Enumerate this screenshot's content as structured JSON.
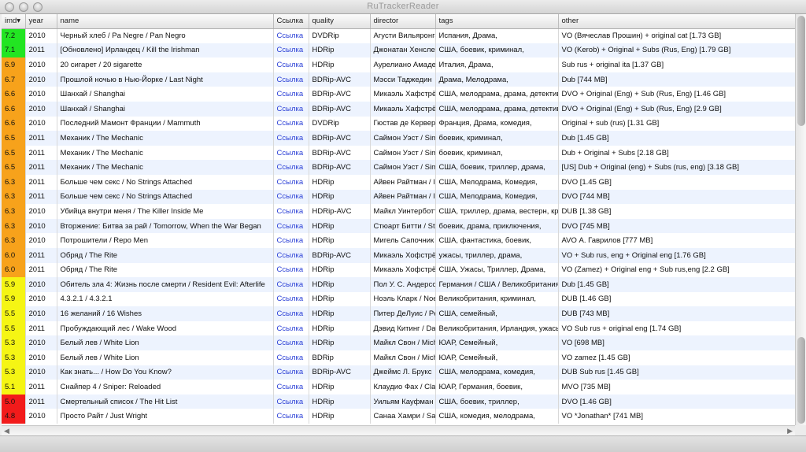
{
  "window": {
    "title": "RuTrackerReader"
  },
  "columns": [
    "imd▾",
    "year",
    "name",
    "Ссылка",
    "quality",
    "director",
    "tags",
    "other"
  ],
  "colors": {
    "green": "#22e522",
    "yellow": "#f5f514",
    "orange": "#f7a21b",
    "red": "#f21b1b",
    "link": "#2a3fd6"
  },
  "rows": [
    {
      "imdb": "7.2",
      "color": "green",
      "year": "2010",
      "name": "Черный хлеб / Pa Negre / Pan Negro",
      "link": "Ссылка",
      "quality": "DVDRip",
      "director": "Агусти Вильяронга",
      "tags": "Испания, Драма,",
      "other": "VO (Вячеслав Прошин) + original cat [1.73 GB]"
    },
    {
      "imdb": "7.1",
      "color": "green",
      "year": "2011",
      "name": "[Обновлено] Ирландец / Kill the Irishman",
      "link": "Ссылка",
      "quality": "HDRip",
      "director": "Джонатан Хенслей",
      "tags": "США, боевик, криминал,",
      "other": "VO (Kerob) + Original + Subs (Rus, Eng) [1.79 GB]"
    },
    {
      "imdb": "6.9",
      "color": "orange",
      "year": "2010",
      "name": "20 сигарет / 20 sigarette",
      "link": "Ссылка",
      "quality": "HDRip",
      "director": "Аурелиано Амадеи",
      "tags": "Италия, Драма,",
      "other": "Sub rus + original ita [1.37 GB]"
    },
    {
      "imdb": "6.7",
      "color": "orange",
      "year": "2010",
      "name": "Прошлой ночью в Нью-Йорке / Last Night",
      "link": "Ссылка",
      "quality": "BDRip-AVC",
      "director": "Мэсси Таджедин",
      "tags": "Драма, Мелодрама,",
      "other": "Dub [744 MB]"
    },
    {
      "imdb": "6.6",
      "color": "orange",
      "year": "2010",
      "name": "Шанхай / Shanghai",
      "link": "Ссылка",
      "quality": "BDRip-AVC",
      "director": "Микаэль Хафстрём",
      "tags": "США, мелодрама, драма, детектив",
      "other": "DVO + Original (Eng) + Sub (Rus, Eng) [1.46 GB]"
    },
    {
      "imdb": "6.6",
      "color": "orange",
      "year": "2010",
      "name": "Шанхай / Shanghai",
      "link": "Ссылка",
      "quality": "BDRip-AVC",
      "director": "Микаэль Хафстрём",
      "tags": "США, мелодрама, драма, детектив",
      "other": "DVO + Original (Eng) + Sub (Rus, Eng) [2.9 GB]"
    },
    {
      "imdb": "6.6",
      "color": "orange",
      "year": "2010",
      "name": "Последний Мамонт Франции / Mammuth",
      "link": "Ссылка",
      "quality": "DVDRip",
      "director": "Гюстав де Керверн",
      "tags": "Франция, Драма, комедия,",
      "other": "Original + sub (rus) [1.31 GB]"
    },
    {
      "imdb": "6.5",
      "color": "orange",
      "year": "2011",
      "name": "Механик / The Mechanic",
      "link": "Ссылка",
      "quality": "BDRip-AVC",
      "director": "Саймон Уэст / Simon",
      "tags": "боевик, криминал,",
      "other": "Dub [1.45 GB]"
    },
    {
      "imdb": "6.5",
      "color": "orange",
      "year": "2011",
      "name": "Механик / The Mechanic",
      "link": "Ссылка",
      "quality": "BDRip-AVC",
      "director": "Саймон Уэст / Simon",
      "tags": "боевик, криминал,",
      "other": "Dub + Original + Subs [2.18 GB]"
    },
    {
      "imdb": "6.5",
      "color": "orange",
      "year": "2011",
      "name": "Механик / The Mechanic",
      "link": "Ссылка",
      "quality": "BDRip-AVC",
      "director": "Саймон Уэст / Simon",
      "tags": "США, боевик, триллер, драма,",
      "other": "[US] Dub + Original (eng) + Subs (rus, eng) [3.18 GB]"
    },
    {
      "imdb": "6.3",
      "color": "orange",
      "year": "2011",
      "name": "Больше чем секс / No Strings Attached",
      "link": "Ссылка",
      "quality": "HDRip",
      "director": "Айвен Райтман / Ivan",
      "tags": "США, Мелодрама, Комедия,",
      "other": "DVO [1.45 GB]"
    },
    {
      "imdb": "6.3",
      "color": "orange",
      "year": "2011",
      "name": "Больше чем секс / No Strings Attached",
      "link": "Ссылка",
      "quality": "HDRip",
      "director": "Айвен Райтман / Ivan",
      "tags": "США, Мелодрама, Комедия,",
      "other": "DVO [744 MB]"
    },
    {
      "imdb": "6.3",
      "color": "orange",
      "year": "2010",
      "name": "Убийца внутри меня / The Killer Inside Me",
      "link": "Ссылка",
      "quality": "HDRip-AVC",
      "director": "Майкл Уинтерботтом",
      "tags": "США, триллер, драма, вестерн, кри",
      "other": "DUB [1.38 GB]"
    },
    {
      "imdb": "6.3",
      "color": "orange",
      "year": "2010",
      "name": "Вторжение: Битва за рай / Tomorrow, When the War Began",
      "link": "Ссылка",
      "quality": "HDRip",
      "director": "Стюарт Битти / Stuart",
      "tags": "боевик, драма, приключения,",
      "other": "DVO [745 MB]"
    },
    {
      "imdb": "6.3",
      "color": "orange",
      "year": "2010",
      "name": "Потрошители / Repo Men",
      "link": "Ссылка",
      "quality": "HDRip",
      "director": "Мигель Сапочник",
      "tags": "США, фантастика, боевик,",
      "other": "AVO А. Гаврилов [777 MB]"
    },
    {
      "imdb": "6.0",
      "color": "orange",
      "year": "2011",
      "name": "Обряд / The Rite",
      "link": "Ссылка",
      "quality": "BDRip-AVC",
      "director": "Микаэль Хофстрём",
      "tags": "ужасы, триллер, драма,",
      "other": "VO + Sub rus, eng + Original eng [1.76 GB]"
    },
    {
      "imdb": "6.0",
      "color": "orange",
      "year": "2011",
      "name": "Обряд / The Rite",
      "link": "Ссылка",
      "quality": "HDRip",
      "director": "Микаэль Хофстрём",
      "tags": "США, Ужасы, Триллер, Драма,",
      "other": "VO (Zamez) + Original eng + Sub rus,eng [2.2 GB]"
    },
    {
      "imdb": "5.9",
      "color": "yellow",
      "year": "2010",
      "name": "Обитель зла 4: Жизнь после смерти / Resident Evil: Afterlife",
      "link": "Ссылка",
      "quality": "HDRip",
      "director": "Пол У. С. Андерсон",
      "tags": "Германия / США / Великобритания",
      "other": "Dub [1.45 GB]"
    },
    {
      "imdb": "5.9",
      "color": "yellow",
      "year": "2010",
      "name": "4.3.2.1 / 4.3.2.1",
      "link": "Ссылка",
      "quality": "HDRip",
      "director": "Ноэль Кларк / Noel",
      "tags": "Великобритания, криминал,",
      "other": "DUB [1.46 GB]"
    },
    {
      "imdb": "5.5",
      "color": "yellow",
      "year": "2010",
      "name": "16 желаний / 16 Wishes",
      "link": "Ссылка",
      "quality": "HDRip",
      "director": "Питер ДеЛуис / Peter",
      "tags": "США, семейный,",
      "other": "DUB [743 MB]"
    },
    {
      "imdb": "5.5",
      "color": "yellow",
      "year": "2011",
      "name": "Пробуждающий лес / Wake Wood",
      "link": "Ссылка",
      "quality": "HDRip",
      "director": "Дэвид Китинг / David",
      "tags": "Великобритания, Ирландия, ужасы",
      "other": "VO Sub rus + original eng [1.74 GB]"
    },
    {
      "imdb": "5.3",
      "color": "yellow",
      "year": "2010",
      "name": "Белый лев / White Lion",
      "link": "Ссылка",
      "quality": "HDRip",
      "director": "Майкл Свон / Michael",
      "tags": "ЮАР, Семейный,",
      "other": "VO [698 MB]"
    },
    {
      "imdb": "5.3",
      "color": "yellow",
      "year": "2010",
      "name": "Белый лев / White Lion",
      "link": "Ссылка",
      "quality": "BDRip",
      "director": "Майкл Свон / Michael",
      "tags": "ЮАР, Семейный,",
      "other": "VO zamez [1.45 GB]"
    },
    {
      "imdb": "5.3",
      "color": "yellow",
      "year": "2010",
      "name": "Как знать... / How Do You Know?",
      "link": "Ссылка",
      "quality": "BDRip-AVC",
      "director": "Джеймс Л. Брукс",
      "tags": "США, мелодрама, комедия,",
      "other": "DUB Sub rus [1.45 GB]"
    },
    {
      "imdb": "5.1",
      "color": "yellow",
      "year": "2011",
      "name": "Снайпер 4 / Sniper: Reloaded",
      "link": "Ссылка",
      "quality": "HDRip",
      "director": "Клаудио Фах / Claudio",
      "tags": "ЮАР, Германия, боевик,",
      "other": "MVO [735 MB]"
    },
    {
      "imdb": "5.0",
      "color": "red",
      "year": "2011",
      "name": "Смертельный список / The Hit List",
      "link": "Ссылка",
      "quality": "HDRip",
      "director": "Уильям Кауфман",
      "tags": "США, боевик, триллер,",
      "other": "DVO [1.46 GB]"
    },
    {
      "imdb": "4.8",
      "color": "red",
      "year": "2010",
      "name": "Просто Райт / Just Wright",
      "link": "Ссылка",
      "quality": "HDRip",
      "director": "Санаа Хамри / Sanaa",
      "tags": "США, комедия, мелодрама,",
      "other": "VO *Jonathan* [741 MB]"
    }
  ]
}
